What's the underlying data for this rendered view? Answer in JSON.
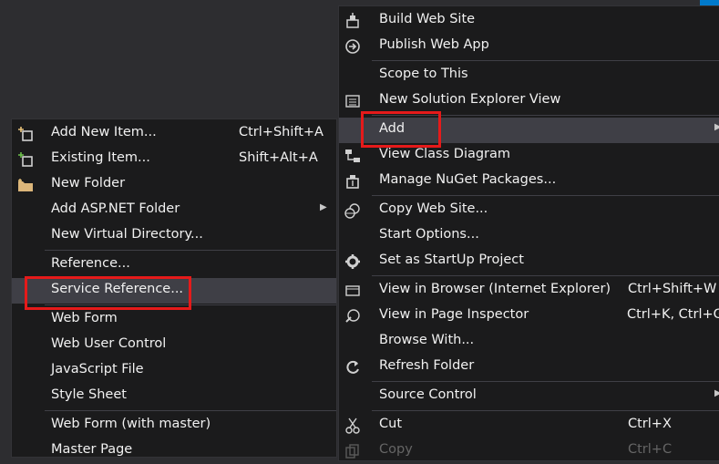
{
  "right_menu": {
    "items": [
      {
        "label": "Build Web Site",
        "icon": "build-icon"
      },
      {
        "label": "Publish Web App",
        "icon": "publish-icon"
      },
      {
        "label": "Scope to This"
      },
      {
        "label": "New Solution Explorer View",
        "icon": "solution-explorer-icon"
      },
      {
        "label": "Add",
        "submenu": true,
        "highlighted": true
      },
      {
        "label": "View Class Diagram",
        "icon": "class-diagram-icon"
      },
      {
        "label": "Manage NuGet Packages...",
        "icon": "nuget-icon"
      },
      {
        "label": "Copy Web Site...",
        "icon": "copy-web-site-icon"
      },
      {
        "label": "Start Options..."
      },
      {
        "label": "Set as StartUp Project",
        "icon": "gear-icon"
      },
      {
        "label": "View in Browser (Internet Explorer)",
        "shortcut": "Ctrl+Shift+W",
        "icon": "browser-icon"
      },
      {
        "label": "View in Page Inspector",
        "shortcut": "Ctrl+K, Ctrl+G",
        "icon": "page-inspector-icon"
      },
      {
        "label": "Browse With..."
      },
      {
        "label": "Refresh Folder",
        "icon": "refresh-icon"
      },
      {
        "label": "Source Control",
        "submenu": true
      },
      {
        "label": "Cut",
        "shortcut": "Ctrl+X",
        "icon": "scissors-icon"
      },
      {
        "label": "Copy",
        "shortcut": "Ctrl+C",
        "icon": "copy-icon",
        "disabled": true
      }
    ]
  },
  "left_menu": {
    "items": [
      {
        "label": "Add New Item...",
        "shortcut": "Ctrl+Shift+A",
        "icon": "new-item-icon"
      },
      {
        "label": "Existing Item...",
        "shortcut": "Shift+Alt+A",
        "icon": "existing-item-icon"
      },
      {
        "label": "New Folder",
        "icon": "folder-icon"
      },
      {
        "label": "Add ASP.NET Folder",
        "submenu": true
      },
      {
        "label": "New Virtual Directory..."
      },
      {
        "label": "Reference..."
      },
      {
        "label": "Service Reference...",
        "highlighted": true
      },
      {
        "label": "Web Form"
      },
      {
        "label": "Web User Control"
      },
      {
        "label": "JavaScript File"
      },
      {
        "label": "Style Sheet"
      },
      {
        "label": "Web Form (with master)"
      },
      {
        "label": "Master Page"
      }
    ]
  },
  "colors": {
    "menu_bg": "#1b1b1c",
    "hover_bg": "#3f3f46",
    "highlight_box": "#e51a1a",
    "text": "#f1f1f1"
  }
}
